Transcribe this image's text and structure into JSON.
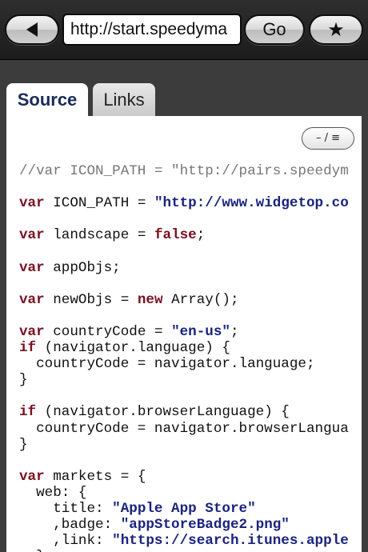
{
  "toolbar": {
    "back_icon": "back-arrow-icon",
    "url": "http://start.speedyma",
    "go_label": "Go",
    "bookmark_label": "★"
  },
  "tabs": [
    {
      "label": "Source",
      "active": true
    },
    {
      "label": "Links",
      "active": false
    }
  ],
  "wrap_toggle_label": "– / ≡",
  "code_lines": [
    [
      {
        "t": "//var ICON_PATH = \"http://pairs.speedym",
        "c": "cm"
      }
    ],
    [],
    [
      {
        "t": "var",
        "c": "kw"
      },
      {
        "t": " ICON_PATH = ",
        "c": ""
      },
      {
        "t": "\"http://www.widgetop.co",
        "c": "str"
      }
    ],
    [],
    [
      {
        "t": "var",
        "c": "kw"
      },
      {
        "t": " landscape = ",
        "c": ""
      },
      {
        "t": "false",
        "c": "kw"
      },
      {
        "t": ";",
        "c": ""
      }
    ],
    [],
    [
      {
        "t": "var",
        "c": "kw"
      },
      {
        "t": " appObjs;",
        "c": ""
      }
    ],
    [],
    [
      {
        "t": "var",
        "c": "kw"
      },
      {
        "t": " newObjs = ",
        "c": ""
      },
      {
        "t": "new",
        "c": "kw"
      },
      {
        "t": " Array();",
        "c": ""
      }
    ],
    [],
    [
      {
        "t": "var",
        "c": "kw"
      },
      {
        "t": " countryCode = ",
        "c": ""
      },
      {
        "t": "\"en-us\"",
        "c": "str"
      },
      {
        "t": ";",
        "c": ""
      }
    ],
    [
      {
        "t": "if",
        "c": "kw"
      },
      {
        "t": " (navigator.language) {",
        "c": ""
      }
    ],
    [
      {
        "t": "  countryCode = navigator.language;",
        "c": ""
      }
    ],
    [
      {
        "t": "}",
        "c": ""
      }
    ],
    [],
    [
      {
        "t": "if",
        "c": "kw"
      },
      {
        "t": " (navigator.browserLanguage) {",
        "c": ""
      }
    ],
    [
      {
        "t": "  countryCode = navigator.browserLangua",
        "c": ""
      }
    ],
    [
      {
        "t": "}",
        "c": ""
      }
    ],
    [],
    [
      {
        "t": "var",
        "c": "kw"
      },
      {
        "t": " markets = {",
        "c": ""
      }
    ],
    [
      {
        "t": "  web: {",
        "c": ""
      }
    ],
    [
      {
        "t": "    title: ",
        "c": ""
      },
      {
        "t": "\"Apple App Store\"",
        "c": "str"
      }
    ],
    [
      {
        "t": "    ,badge: ",
        "c": ""
      },
      {
        "t": "\"appStoreBadge2.png\"",
        "c": "str"
      }
    ],
    [
      {
        "t": "    ,link: ",
        "c": ""
      },
      {
        "t": "\"https://search.itunes.apple",
        "c": "str"
      }
    ],
    [
      {
        "t": "  },",
        "c": ""
      }
    ]
  ]
}
